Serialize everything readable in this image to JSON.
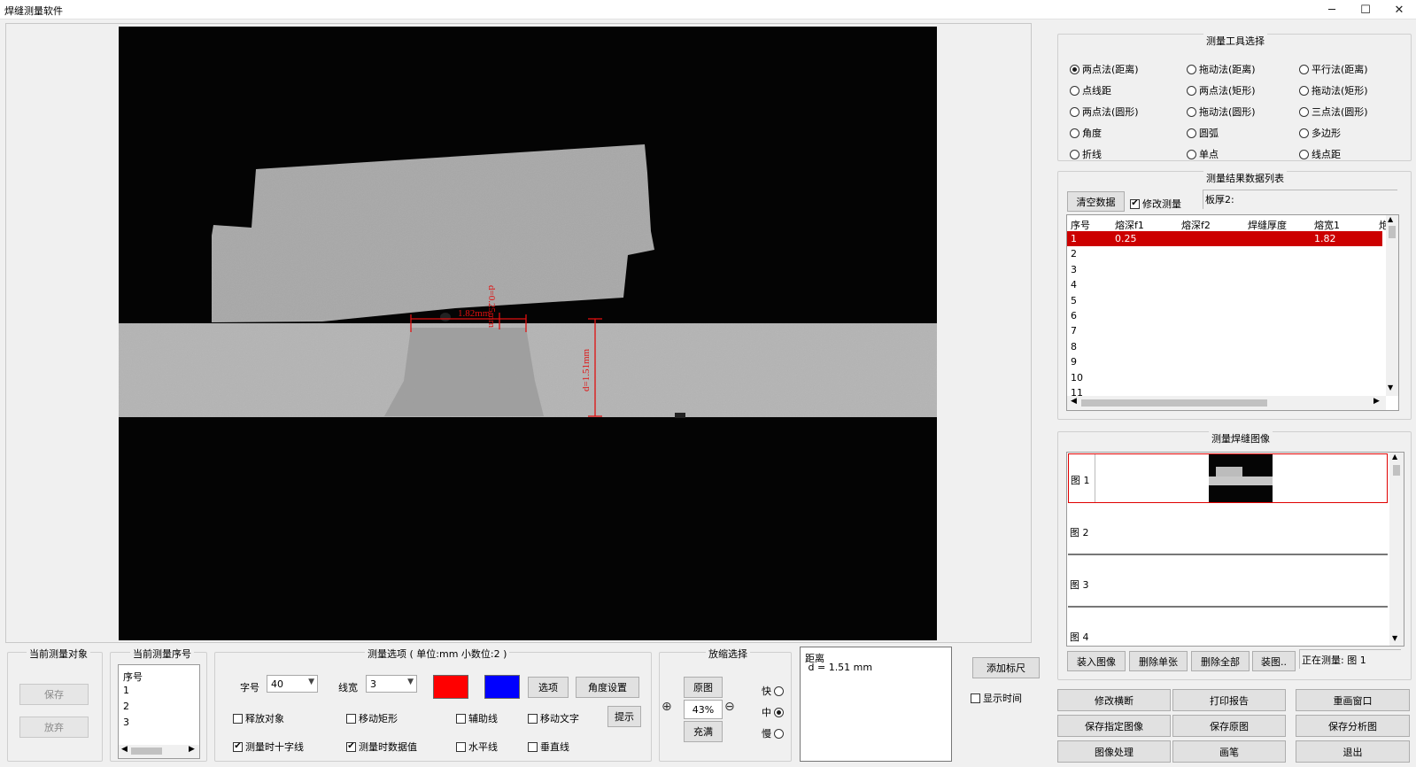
{
  "window": {
    "title": "焊缝测量软件",
    "minimize": "─",
    "maximize": "☐",
    "close": "✕"
  },
  "image_overlay": {
    "label_width": "1.82mm",
    "label_gap": "d=0.25mm",
    "label_thickness": "d=1.51mm"
  },
  "tools": {
    "title": "测量工具选择",
    "options": [
      {
        "label": "两点法(距离)",
        "selected": true
      },
      {
        "label": "拖动法(距离)",
        "selected": false
      },
      {
        "label": "平行法(距离)",
        "selected": false
      },
      {
        "label": "点线距",
        "selected": false
      },
      {
        "label": "两点法(矩形)",
        "selected": false
      },
      {
        "label": "拖动法(矩形)",
        "selected": false
      },
      {
        "label": "两点法(圆形)",
        "selected": false
      },
      {
        "label": "拖动法(圆形)",
        "selected": false
      },
      {
        "label": "三点法(圆形)",
        "selected": false
      },
      {
        "label": "角度",
        "selected": false
      },
      {
        "label": "圆弧",
        "selected": false
      },
      {
        "label": "多边形",
        "selected": false
      },
      {
        "label": "折线",
        "selected": false
      },
      {
        "label": "单点",
        "selected": false
      },
      {
        "label": "线点距",
        "selected": false
      }
    ]
  },
  "results": {
    "title": "测量结果数据列表",
    "clear_button": "清空数据",
    "modify_check": "修改测量",
    "plate_thickness_label": "板厚2:",
    "columns": [
      "序号",
      "熔深f1",
      "熔深f2",
      "焊缝厚度",
      "熔宽1",
      "炮"
    ],
    "rows": [
      {
        "no": "1",
        "f1": "0.25",
        "f2": "",
        "thick": "",
        "w1": "1.82"
      },
      {
        "no": "2",
        "f1": "",
        "f2": "",
        "thick": "",
        "w1": ""
      },
      {
        "no": "3",
        "f1": "",
        "f2": "",
        "thick": "",
        "w1": ""
      },
      {
        "no": "4",
        "f1": "",
        "f2": "",
        "thick": "",
        "w1": ""
      },
      {
        "no": "5",
        "f1": "",
        "f2": "",
        "thick": "",
        "w1": ""
      },
      {
        "no": "6",
        "f1": "",
        "f2": "",
        "thick": "",
        "w1": ""
      },
      {
        "no": "7",
        "f1": "",
        "f2": "",
        "thick": "",
        "w1": ""
      },
      {
        "no": "8",
        "f1": "",
        "f2": "",
        "thick": "",
        "w1": ""
      },
      {
        "no": "9",
        "f1": "",
        "f2": "",
        "thick": "",
        "w1": ""
      },
      {
        "no": "10",
        "f1": "",
        "f2": "",
        "thick": "",
        "w1": ""
      },
      {
        "no": "11",
        "f1": "",
        "f2": "",
        "thick": "",
        "w1": ""
      }
    ]
  },
  "images": {
    "title": "测量焊缝图像",
    "items": [
      "图 1",
      "图 2",
      "图 3",
      "图 4"
    ],
    "load_button": "装入图像",
    "delete_one_button": "删除单张",
    "delete_all_button": "删除全部",
    "more_button": "装图..",
    "current_label": "正在测量: 图 1"
  },
  "bottom_right_buttons": [
    "修改横断",
    "打印报告",
    "重画窗口",
    "保存指定图像",
    "保存原图",
    "保存分析图",
    "图像处理",
    "画笔",
    "退出"
  ],
  "current_object": {
    "title": "当前测量对象",
    "save_button": "保存",
    "discard_button": "放弃"
  },
  "current_index": {
    "title": "当前测量序号",
    "items": [
      "序号",
      "1",
      "2",
      "3"
    ]
  },
  "options": {
    "title": "测量选项 ( 单位:mm  小数位:2 )",
    "font_label": "字号",
    "font_value": "40",
    "line_label": "线宽",
    "line_value": "3",
    "color1": "#ff0000",
    "color2": "#0000ff",
    "options_button": "选项",
    "angle_button": "角度设置",
    "hint_button": "提示",
    "checks": [
      {
        "label": "释放对象",
        "checked": false
      },
      {
        "label": "移动矩形",
        "checked": false
      },
      {
        "label": "辅助线",
        "checked": false
      },
      {
        "label": "移动文字",
        "checked": false
      },
      {
        "label": "测量时十字线",
        "checked": true
      },
      {
        "label": "测量时数据值",
        "checked": true
      },
      {
        "label": "水平线",
        "checked": false
      },
      {
        "label": "垂直线",
        "checked": false
      }
    ]
  },
  "zoom": {
    "title": "放缩选择",
    "original_button": "原图",
    "value": "43%",
    "fill_button": "充满",
    "speeds": [
      {
        "label": "快",
        "selected": false
      },
      {
        "label": "中",
        "selected": true
      },
      {
        "label": "慢",
        "selected": false
      }
    ]
  },
  "info": {
    "line1": "距离",
    "line2": " d = 1.51 mm"
  },
  "ruler": {
    "add_button": "添加标尺",
    "show_time": "显示时间"
  }
}
